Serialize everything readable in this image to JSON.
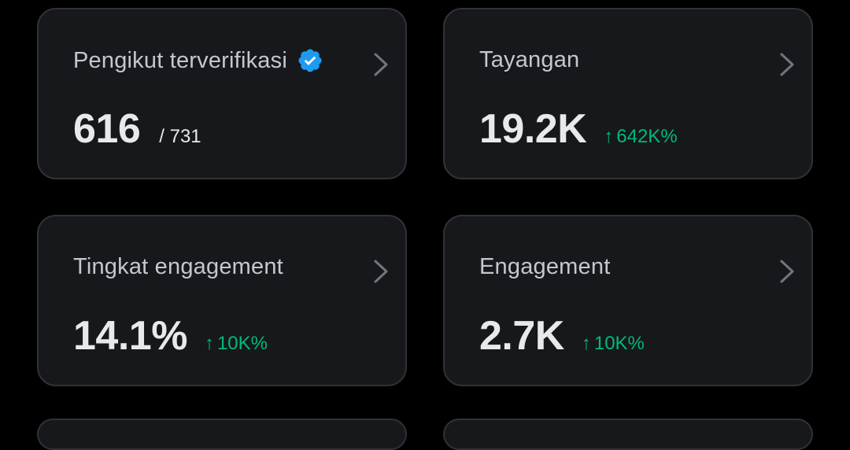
{
  "colors": {
    "background": "#000000",
    "card_background": "#16181c",
    "card_border": "#2f3336",
    "label": "#c4c8cc",
    "value": "#e7e9ea",
    "positive": "#00ba7c",
    "verified": "#1d9bf0",
    "chevron": "#71767b"
  },
  "cards": [
    {
      "label": "Pengikut terverifikasi",
      "icon": "verified-badge-icon",
      "value": "616",
      "total": "/ 731",
      "chevron_icon": "chevron-right-icon"
    },
    {
      "label": "Tayangan",
      "value": "19.2K",
      "delta_arrow": "↑",
      "delta": "642K%",
      "chevron_icon": "chevron-right-icon"
    },
    {
      "label": "Tingkat engagement",
      "value": "14.1%",
      "delta_arrow": "↑",
      "delta": "10K%",
      "chevron_icon": "chevron-right-icon"
    },
    {
      "label": "Engagement",
      "value": "2.7K",
      "delta_arrow": "↑",
      "delta": "10K%",
      "chevron_icon": "chevron-right-icon"
    }
  ]
}
